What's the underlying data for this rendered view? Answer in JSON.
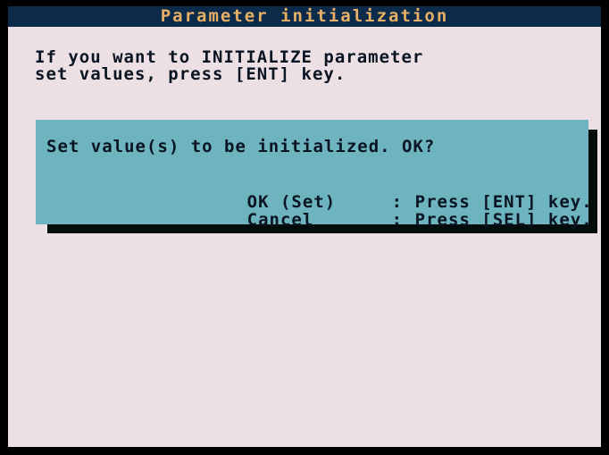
{
  "title": "Parameter initialization",
  "instruction": {
    "line1": "If you want to INITIALIZE parameter",
    "line2": "set values, press [ENT] key."
  },
  "dialog": {
    "question": "Set value(s) to be initialized. OK?",
    "ok": {
      "label": "OK (Set)",
      "sep": ":",
      "action": "Press [ENT] key."
    },
    "cancel": {
      "label": "Cancel",
      "sep": ":",
      "action": "Press [SEL] key."
    }
  },
  "colors": {
    "title_bg": "#0c2a4a",
    "title_text": "#e8b064",
    "screen_bg": "#ece0e4",
    "dialog_bg": "#6db4be",
    "text": "#0a1422"
  }
}
